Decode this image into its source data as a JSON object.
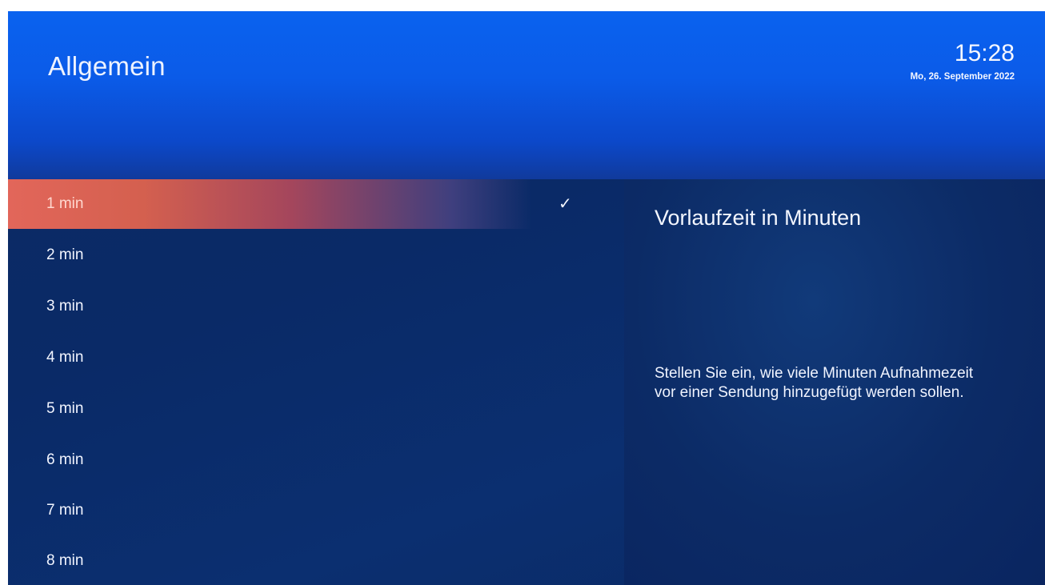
{
  "header": {
    "title": "Allgemein",
    "time": "15:28",
    "date": "Mo, 26. September 2022"
  },
  "options": [
    {
      "label": "1 min",
      "selected": true
    },
    {
      "label": "2 min",
      "selected": false
    },
    {
      "label": "3 min",
      "selected": false
    },
    {
      "label": "4 min",
      "selected": false
    },
    {
      "label": "5 min",
      "selected": false
    },
    {
      "label": "6 min",
      "selected": false
    },
    {
      "label": "7 min",
      "selected": false
    },
    {
      "label": "8 min",
      "selected": false
    }
  ],
  "check_icon": "checkmark-icon",
  "info": {
    "title": "Vorlaufzeit in Minuten",
    "description": "Stellen Sie ein, wie viele Minuten Aufnahmezeit vor einer Sendung hinzugefügt werden sollen."
  },
  "colors": {
    "header_blue": "#0a62ef",
    "background_navy": "#0c2a63",
    "highlight_orange": "#e2665a"
  }
}
